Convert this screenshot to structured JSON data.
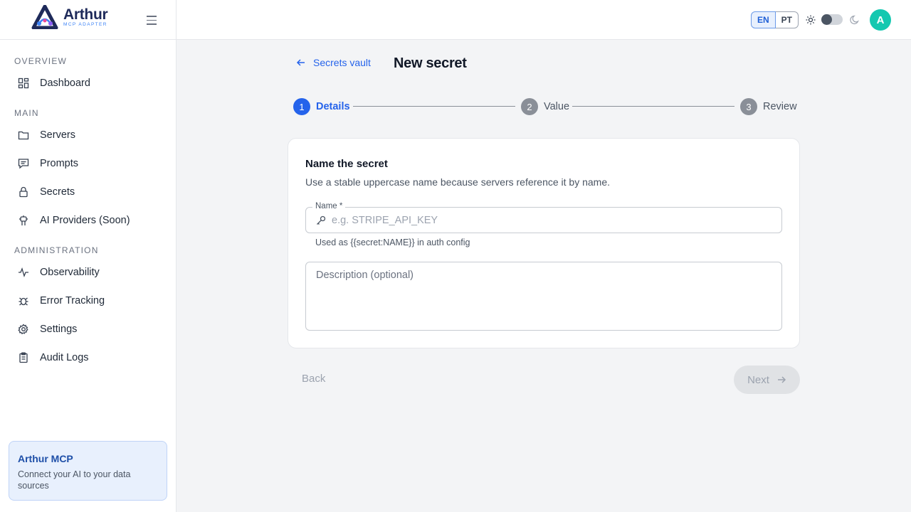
{
  "brand": {
    "name": "Arthur",
    "subtitle": "MCP ADAPTER"
  },
  "sidebar": {
    "sections": [
      {
        "title": "OVERVIEW",
        "items": [
          {
            "label": "Dashboard",
            "icon": "dashboard-icon"
          }
        ]
      },
      {
        "title": "MAIN",
        "items": [
          {
            "label": "Servers",
            "icon": "folder-icon"
          },
          {
            "label": "Prompts",
            "icon": "message-icon"
          },
          {
            "label": "Secrets",
            "icon": "lock-icon"
          },
          {
            "label": "AI Providers (Soon)",
            "icon": "robot-icon"
          }
        ]
      },
      {
        "title": "ADMINISTRATION",
        "items": [
          {
            "label": "Observability",
            "icon": "activity-icon"
          },
          {
            "label": "Error Tracking",
            "icon": "bug-icon"
          },
          {
            "label": "Settings",
            "icon": "gear-icon"
          },
          {
            "label": "Audit Logs",
            "icon": "clipboard-icon"
          }
        ]
      }
    ],
    "card": {
      "title": "Arthur MCP",
      "description": "Connect your AI to your data sources"
    }
  },
  "topbar": {
    "languages": [
      "EN",
      "PT"
    ],
    "active_language": "EN",
    "avatar_initial": "A",
    "dark_mode": false
  },
  "page": {
    "back_label": "Secrets vault",
    "title": "New secret"
  },
  "stepper": {
    "steps": [
      {
        "number": "1",
        "label": "Details",
        "active": true
      },
      {
        "number": "2",
        "label": "Value",
        "active": false
      },
      {
        "number": "3",
        "label": "Review",
        "active": false
      }
    ]
  },
  "form": {
    "title": "Name the secret",
    "description": "Use a stable uppercase name because servers reference it by name.",
    "name_label": "Name *",
    "name_placeholder": "e.g. STRIPE_API_KEY",
    "name_value": "",
    "name_helper": "Used as {{secret:NAME}} in auth config",
    "description_placeholder": "Description (optional)"
  },
  "actions": {
    "back_label": "Back",
    "next_label": "Next"
  },
  "colors": {
    "primary": "#2563eb",
    "avatar": "#14c8b0",
    "card_bg": "#e8f0fd"
  }
}
